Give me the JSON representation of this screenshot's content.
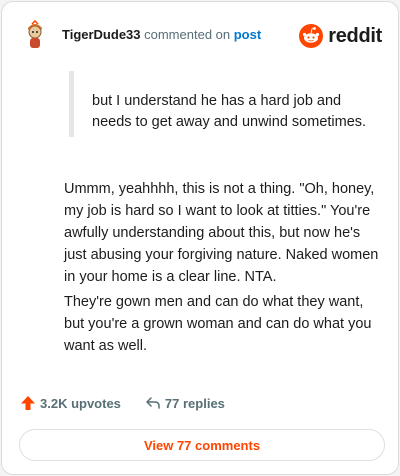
{
  "header": {
    "username": "TigerDude33",
    "action_text": " commented on ",
    "post_link": "post",
    "logo_text": "reddit"
  },
  "comment": {
    "quote": "but I understand he has a hard job and needs to get away and unwind sometimes.",
    "paragraph_1": "Ummm, yeahhhh, this is not a thing. \"Oh, honey, my job is hard so I want to look at titties.\" You're awfully understanding about this, but now he's just abusing your forgiving nature. Naked women in your home is a clear line. NTA.",
    "paragraph_2": "They're gown men and can do what they want, but you're a grown woman and can do what you want as well."
  },
  "stats": {
    "upvotes": "3.2K upvotes",
    "replies": "77 replies"
  },
  "footer": {
    "view_button": "View 77 comments"
  },
  "colors": {
    "accent": "#ff4500",
    "link": "#0079d3",
    "muted": "#576f76"
  },
  "icons": {
    "avatar": "snoo-avatar-icon",
    "logo": "reddit-snoo-icon",
    "upvote": "upvote-arrow-icon",
    "reply": "reply-arrow-icon"
  }
}
